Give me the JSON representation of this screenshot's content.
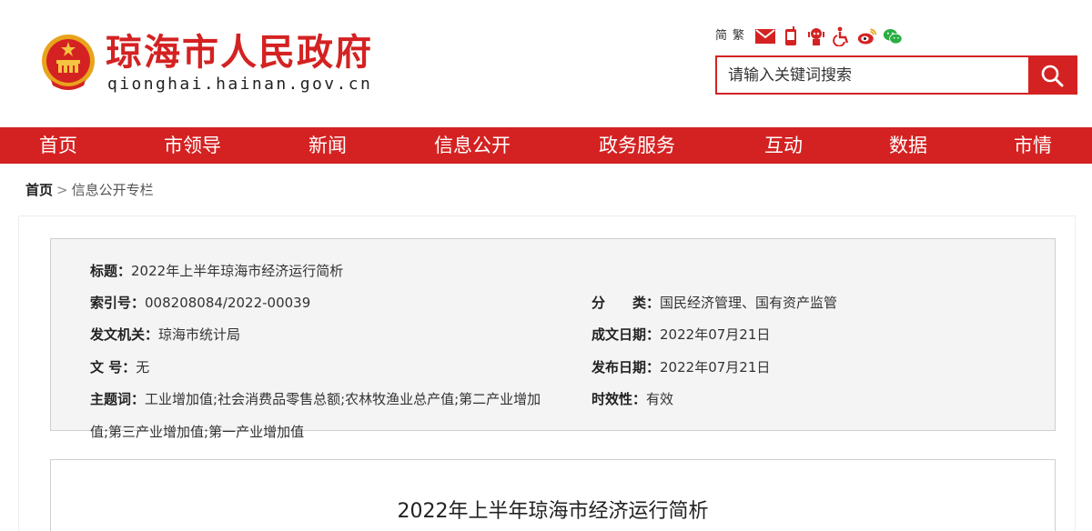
{
  "header": {
    "site_title": "琼海市人民政府",
    "site_domain": "qionghai.hainan.gov.cn",
    "lang_simplified": "简",
    "lang_traditional": "繁",
    "icons": [
      "mail-icon",
      "mobile-icon",
      "robot-icon",
      "accessibility-icon",
      "weibo-icon",
      "wechat-icon"
    ],
    "search_placeholder": "请输入关键词搜索"
  },
  "nav": {
    "items": [
      "首页",
      "市领导",
      "新闻",
      "信息公开",
      "政务服务",
      "互动",
      "数据",
      "市情"
    ]
  },
  "breadcrumb": {
    "home": "首页",
    "separator": ">",
    "current": "信息公开专栏"
  },
  "meta": {
    "title_label": "标题：",
    "title_value": "2022年上半年琼海市经济运行简析",
    "index_label": "索引号：",
    "index_value": "008208084/2022-00039",
    "category_label": "分　　类：",
    "category_value": "国民经济管理、国有资产监管",
    "issuer_label": "发文机关：",
    "issuer_value": "琼海市统计局",
    "written_label": "成文日期：",
    "written_value": "2022年07月21日",
    "docno_label": "文  号：",
    "docno_value": "无",
    "published_label": "发布日期：",
    "published_value": "2022年07月21日",
    "keywords_label": "主题词：",
    "keywords_value": "工业增加值;社会消费品零售总额;农林牧渔业总产值;第二产业增加值;第三产业增加值;第一产业增加值",
    "validity_label": "时效性：",
    "validity_value": "有效"
  },
  "article": {
    "title": "2022年上半年琼海市经济运行简析"
  },
  "colors": {
    "brand_red": "#d42222",
    "meta_bg": "#f4f4f4"
  }
}
